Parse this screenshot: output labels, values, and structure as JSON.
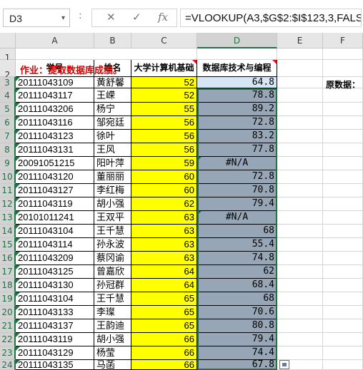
{
  "formula_bar": {
    "name_box": "D3",
    "name_dd": "▾",
    "separator": ":",
    "cancel_icon": "✕",
    "enter_icon": "✓",
    "fx_icon": "fx",
    "formula": "=VLOOKUP(A3,$G$2:$I$123,3,FALSE)"
  },
  "columns": [
    "A",
    "B",
    "C",
    "D",
    "E",
    "F"
  ],
  "row_numbers": [
    "1",
    "2",
    "3",
    "4",
    "5",
    "6",
    "7",
    "8",
    "9",
    "10",
    "11",
    "12",
    "13",
    "14",
    "15",
    "16",
    "17",
    "18",
    "19",
    "20",
    "21",
    "22",
    "23",
    "24"
  ],
  "row1": {
    "title": "作业：提取数据库成绩。"
  },
  "headers": {
    "student_id": "学号",
    "name": "姓名",
    "course_c": "大学计算机基础",
    "course_d": "数据库技术与编程",
    "raw_data": "原数据："
  },
  "rows": [
    {
      "id": "20111043109",
      "name": "黄舒馨",
      "c": "52",
      "d": "64.8"
    },
    {
      "id": "20111043117",
      "name": "王嵘",
      "c": "52",
      "d": "78.8"
    },
    {
      "id": "20111043206",
      "name": "杨宁",
      "c": "55",
      "d": "89.2"
    },
    {
      "id": "20111043116",
      "name": "邹宛廷",
      "c": "56",
      "d": "72.8"
    },
    {
      "id": "20111043123",
      "name": "徐叶",
      "c": "56",
      "d": "83.2"
    },
    {
      "id": "20111043131",
      "name": "王风",
      "c": "56",
      "d": "77.8"
    },
    {
      "id": "20091051215",
      "name": "阳叶萍",
      "c": "59",
      "d": "#N/A"
    },
    {
      "id": "20111043120",
      "name": "董丽丽",
      "c": "60",
      "d": "72.8"
    },
    {
      "id": "20111043127",
      "name": "李红梅",
      "c": "60",
      "d": "70.8"
    },
    {
      "id": "20111043119",
      "name": "胡小强",
      "c": "62",
      "d": "79.4"
    },
    {
      "id": "20101011241",
      "name": "王双平",
      "c": "63",
      "d": "#N/A"
    },
    {
      "id": "20111043104",
      "name": "王千慧",
      "c": "63",
      "d": "68"
    },
    {
      "id": "20111043114",
      "name": "孙永波",
      "c": "63",
      "d": "55.4"
    },
    {
      "id": "20111043209",
      "name": "蔡冈谕",
      "c": "63",
      "d": "74.8"
    },
    {
      "id": "20111043125",
      "name": "曾嘉欣",
      "c": "64",
      "d": "62"
    },
    {
      "id": "20111043130",
      "name": "孙冠群",
      "c": "64",
      "d": "68.4"
    },
    {
      "id": "20111043104",
      "name": "王千慧",
      "c": "65",
      "d": "68"
    },
    {
      "id": "20111043133",
      "name": "李璨",
      "c": "65",
      "d": "70.6"
    },
    {
      "id": "20111043137",
      "name": "王韵迪",
      "c": "65",
      "d": "80.8"
    },
    {
      "id": "20111043119",
      "name": "胡小强",
      "c": "66",
      "d": "79.4"
    },
    {
      "id": "20111043129",
      "name": "杨莹",
      "c": "66",
      "d": "74.4"
    },
    {
      "id": "20111043135",
      "name": "马菡",
      "c": "66",
      "d": "67.8"
    }
  ],
  "colors": {
    "yellow_fill": "#ffff00",
    "gray_fill": "#97a6b6",
    "selection_green": "#217346",
    "title_red": "#d10000"
  }
}
